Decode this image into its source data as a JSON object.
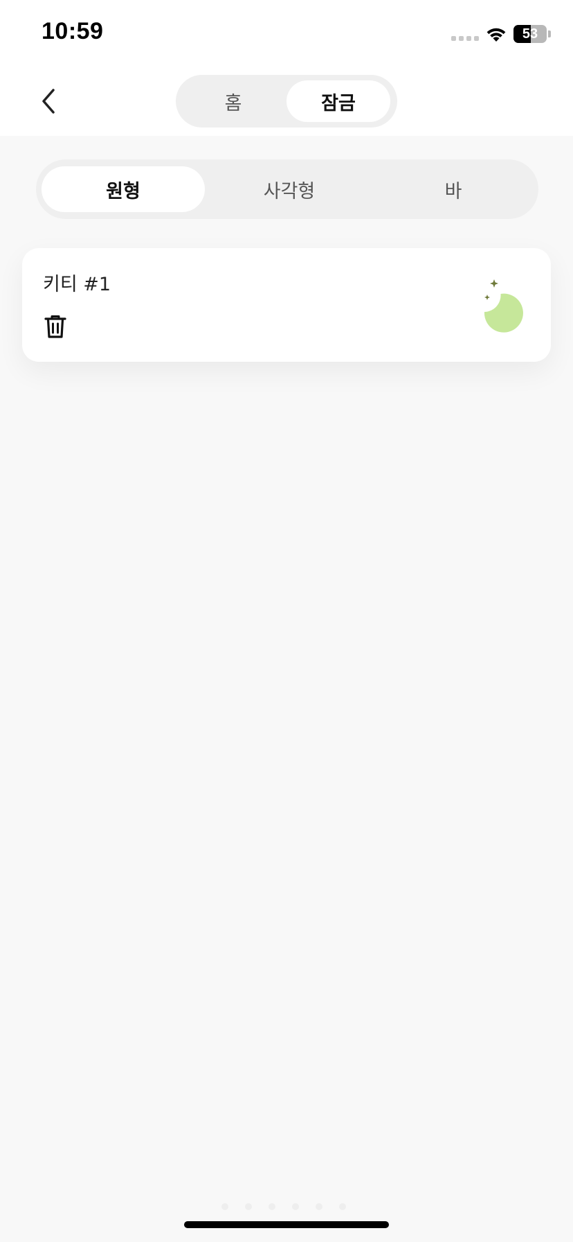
{
  "status_bar": {
    "time": "10:59",
    "battery_level": "53",
    "battery_fraction": 0.53
  },
  "nav": {
    "back_icon": "chevron-left-icon",
    "toggle": {
      "home_label": "홈",
      "sleep_label": "잠금",
      "selected": "잠금"
    }
  },
  "shape_tabs": {
    "circle_label": "원형",
    "square_label": "사각형",
    "bar_label": "바",
    "selected": "원형"
  },
  "widgets": [
    {
      "name": "키티 #1",
      "delete_icon": "trash-icon",
      "preview_icon": "moon-icon",
      "preview_color": "#c6e79a"
    }
  ],
  "colors": {
    "background": "#f8f8f8",
    "card": "#ffffff",
    "segment_track": "#efefef",
    "accent_moon": "#c6e79a",
    "sparkle": "#6f7a3a"
  }
}
